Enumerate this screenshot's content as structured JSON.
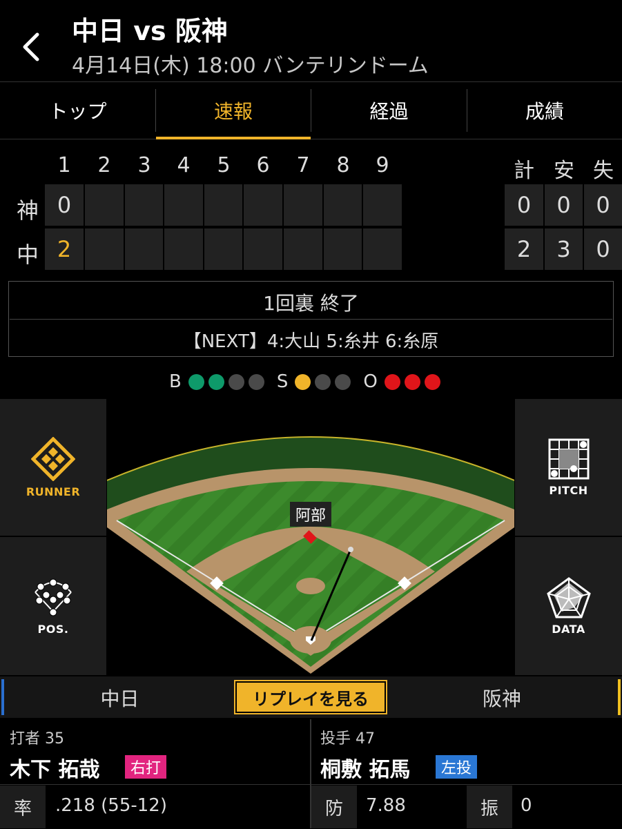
{
  "header": {
    "back_icon": "chevron-left-icon",
    "title": "中日 vs 阪神",
    "subtitle": "4月14日(木) 18:00 バンテリンドーム"
  },
  "tabs": [
    {
      "label": "トップ",
      "active": false
    },
    {
      "label": "速報",
      "active": true
    },
    {
      "label": "経過",
      "active": false
    },
    {
      "label": "成績",
      "active": false
    }
  ],
  "scoreboard": {
    "innings": [
      "1",
      "2",
      "3",
      "4",
      "5",
      "6",
      "7",
      "8",
      "9"
    ],
    "totals_headers": [
      "計",
      "安",
      "失"
    ],
    "teams": [
      {
        "label": "神",
        "scores": [
          "0",
          "",
          "",
          "",
          "",
          "",
          "",
          "",
          ""
        ],
        "totals": [
          "0",
          "0",
          "0"
        ]
      },
      {
        "label": "中",
        "scores": [
          "2",
          "",
          "",
          "",
          "",
          "",
          "",
          "",
          ""
        ],
        "totals": [
          "2",
          "3",
          "0"
        ]
      }
    ]
  },
  "status": {
    "inning": "1回裏 終了",
    "next": "【NEXT】4:大山 5:糸井 6:糸原"
  },
  "count": {
    "ball_label": "B",
    "balls": 2,
    "strike_label": "S",
    "strikes": 1,
    "out_label": "O",
    "outs": 3
  },
  "side_buttons": {
    "runner": "RUNNER",
    "pos": "POS.",
    "pitch": "PITCH",
    "data": "DATA"
  },
  "field": {
    "fielder_name": "阿部"
  },
  "teams_bar": {
    "home": "中日",
    "away": "阪神",
    "replay": "リプレイを見る"
  },
  "batter": {
    "label": "打者 35",
    "name": "木下 拓哉",
    "badge": "右打",
    "stat_key": "率",
    "stat_val": ".218 (55-12)"
  },
  "pitcher": {
    "label": "投手 47",
    "name": "桐敷 拓馬",
    "badge": "左投",
    "stat1_key": "防",
    "stat1_val": "7.88",
    "stat2_key": "振",
    "stat2_val": "0"
  },
  "colors": {
    "accent": "#f0b42a",
    "ball": "#0e9a6a",
    "strike": "#f0b42a",
    "out": "#e0151a",
    "off": "#4a4a4a",
    "batter_badge": "#e2247f",
    "pitcher_badge": "#2a77d4"
  }
}
